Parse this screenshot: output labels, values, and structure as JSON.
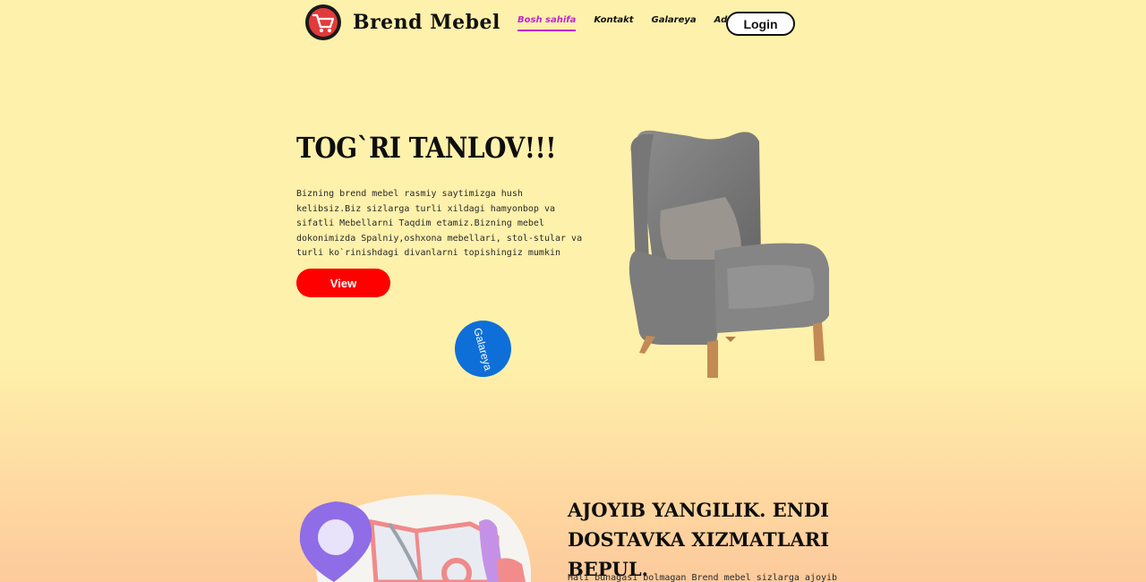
{
  "brand": {
    "name": "Brend Mebel",
    "logo_icon": "shopping-cart-icon"
  },
  "nav": {
    "links": [
      "Bosh sahifa",
      "Kontakt",
      "Galareya",
      "Addres"
    ],
    "active_color": "#c026d3",
    "login": "Login"
  },
  "hero": {
    "title": "Tog`ri tanlov!!!",
    "text": "Bizning brend mebel rasmiy saytimizga hush kelibsiz.Biz sizlarga turli xildagi hamyonbop va sifatli Mebellarni Taqdim etamiz.Bizning mebel dokonimizda Spalniy,oshxona mebellari, stol-stular va turli ko`rinishdagi divanlarni topishingiz mumkin",
    "view_button": "View",
    "gallery_button": "Galareya",
    "accent_red": "#ff0000",
    "accent_blue": "#0f6fd8"
  },
  "delivery": {
    "title": "Ajoyib yangilik. Endi dostavka xizmatlari bepul.",
    "text": "Hali bunagasi bolmagan Brend mebel sizlarga ajoyib"
  }
}
